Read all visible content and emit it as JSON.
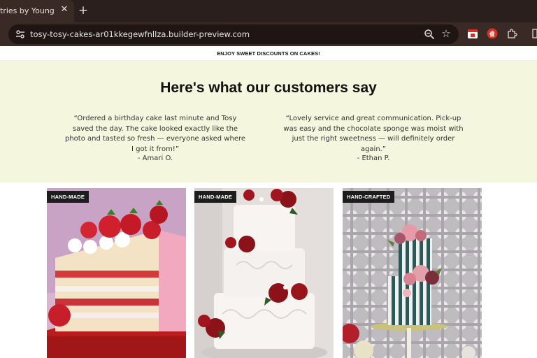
{
  "browser": {
    "tab_title": "tries by Young Enth",
    "url": "tosy-tosy-cakes-ar01kkegewfnllza.builder-preview.com"
  },
  "announcement": "ENJOY SWEET DISCOUNTS ON CAKES!",
  "testimonials": {
    "heading": "Here's what our customers say",
    "items": [
      {
        "quote": "“Ordered a birthday cake last minute and Tosy saved the day. The cake looked exactly like the photo and tasted so fresh — everyone asked where I got it from!”",
        "author": "- Amari O."
      },
      {
        "quote": "“Lovely service and great communication. Pick-up was easy and the chocolate sponge was moist with just the right sweetness — will definitely order again.”",
        "author": "- Ethan P."
      }
    ]
  },
  "products": [
    {
      "badge": "HAND-MADE"
    },
    {
      "badge": "HAND-MADE"
    },
    {
      "badge": "HAND-CRAFTED"
    }
  ],
  "colors": {
    "chrome_bg": "#2a1f1c",
    "toolbar_bg": "#3a2a26",
    "testimonial_bg": "#f4f7de",
    "badge_bg": "#1d1d1d"
  }
}
